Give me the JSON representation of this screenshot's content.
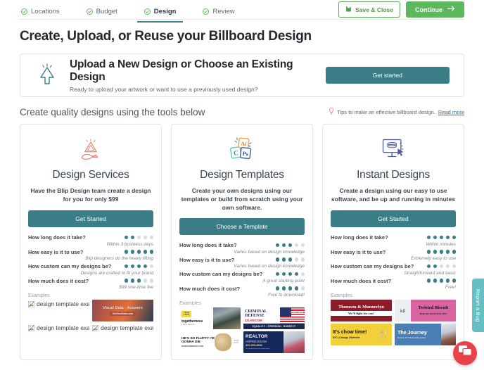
{
  "stepper": {
    "steps": [
      {
        "label": "Locations",
        "state": "complete"
      },
      {
        "label": "Budget",
        "state": "complete"
      },
      {
        "label": "Design",
        "state": "active"
      },
      {
        "label": "Review",
        "state": "complete"
      }
    ],
    "save_label": "Save & Close",
    "continue_label": "Continue"
  },
  "page_title": "Create, Upload, or Reuse your Billboard Design",
  "upload_panel": {
    "icon": "upload-arrow-icon",
    "title": "Upload a New Design or Choose an Existing Design",
    "subtitle": "Ready to upload your artwork or want to use a previously used design?",
    "cta": "Get started"
  },
  "section": {
    "title": "Create quality designs using the tools below",
    "tips_icon": "lightbulb-icon",
    "tips_text": "Tips to make an effective billboard design.",
    "tips_link": "Read more"
  },
  "feature_labels": [
    "How long does it take?",
    "How easy is it to use?",
    "How custom can my designs be?",
    "How much does it cost?"
  ],
  "rating_max": 5,
  "cards": [
    {
      "id": "design-services",
      "icon": "hand-holding-design-icon",
      "title": "Design Services",
      "description": "Have the Blip Design team create a design for you for only $99",
      "cta": "Get Started",
      "features": [
        {
          "label": "How long does it take?",
          "rating": 2,
          "note": "Within 3 business days"
        },
        {
          "label": "How easy is it to use?",
          "rating": 5,
          "note": "Blip designers do the heavy lifting"
        },
        {
          "label": "How custom can my designs be?",
          "rating": 4,
          "note": "Designs are crafted to fit your brand"
        },
        {
          "label": "How much does it cost?",
          "rating": 3,
          "note": "$99 one-time fee"
        }
      ],
      "examples_label": "Examples",
      "examples": [
        {
          "kind": "broken",
          "alt": "design template example"
        },
        {
          "kind": "visualdata",
          "line1": "Visual Data - Answers",
          "line2": "VizYourData.com"
        },
        {
          "kind": "broken",
          "alt": "design template example"
        },
        {
          "kind": "broken",
          "alt": "design template example"
        }
      ]
    },
    {
      "id": "design-templates",
      "icon": "adobe-apps-icon",
      "title": "Design Templates",
      "description": "Create your own designs using our templates or build from scratch using your own software.",
      "cta": "Choose a Template",
      "features": [
        {
          "label": "How long does it take?",
          "rating": 3,
          "note": "Varies based on design knowledge"
        },
        {
          "label": "How easy is it to use?",
          "rating": 3,
          "note": "Varies based on design knowledge"
        },
        {
          "label": "How custom can my designs be?",
          "rating": 4,
          "note": "A great starting point"
        },
        {
          "label": "How much does it cost?",
          "rating": 4,
          "note": "Free to download!"
        }
      ],
      "examples_label": "Examples",
      "examples": [
        {
          "kind": "togetherness",
          "badge": "YOUR LOGO",
          "word": "togetherness",
          "sub": "a better tomorrow"
        },
        {
          "kind": "criminal",
          "line1": "CRIMINAL DEFENSE",
          "line2": "22LAW.COM",
          "logo": "YOUR LOGO",
          "bar": "EQUALITY  •  FREEDOM  •  HONESTY"
        },
        {
          "kind": "fluffy",
          "line1": "HE'S SO FLUFFY I'M GONNA DIE",
          "line2": "BARKSTOREDOGS.COM",
          "logo": "YOUR LOGO"
        },
        {
          "kind": "realtor",
          "line1": "REALTOR",
          "line2": "ASPEN EGAN",
          "line3": "800-555-8888",
          "line4": "Your trusted local real estate expert"
        }
      ]
    },
    {
      "id": "instant-designs",
      "icon": "monitor-cursor-icon",
      "title": "Instant Designs",
      "description": "Create a design using our easy to use software, and be up and running in minutes",
      "cta": "Get Started",
      "features": [
        {
          "label": "How long does it take?",
          "rating": 5,
          "note": "Within minutes"
        },
        {
          "label": "How easy is it to use?",
          "rating": 5,
          "note": "Extremely easy to use"
        },
        {
          "label": "How custom can my designs be?",
          "rating": 2,
          "note": "Straightforward and basic"
        },
        {
          "label": "How much does it cost?",
          "rating": 5,
          "note": "Free!"
        }
      ],
      "examples_label": "Examples",
      "examples": [
        {
          "kind": "thomson",
          "line1": "Thomson & Munnerlyn",
          "line2": "We'll fight for you!"
        },
        {
          "kind": "twisted",
          "line1": "Twisted Biscuit",
          "line2": "Rock the World Tour 2022"
        },
        {
          "kind": "chow",
          "line1": "It's chow time!",
          "line2": "NYC | Chicago | Nashville"
        },
        {
          "kind": "journey",
          "line1": "The Journey",
          "line2": "By Erik, NYT Bestselling Author"
        }
      ]
    }
  ],
  "widgets": {
    "report_bug_label": "Report a Bug",
    "chat_icon": "chat-bubble-icon"
  },
  "colors": {
    "teal": "#3a7d87",
    "green": "#5cb85c",
    "chat_red": "#e8414a",
    "bug_teal": "#65c0c4"
  }
}
